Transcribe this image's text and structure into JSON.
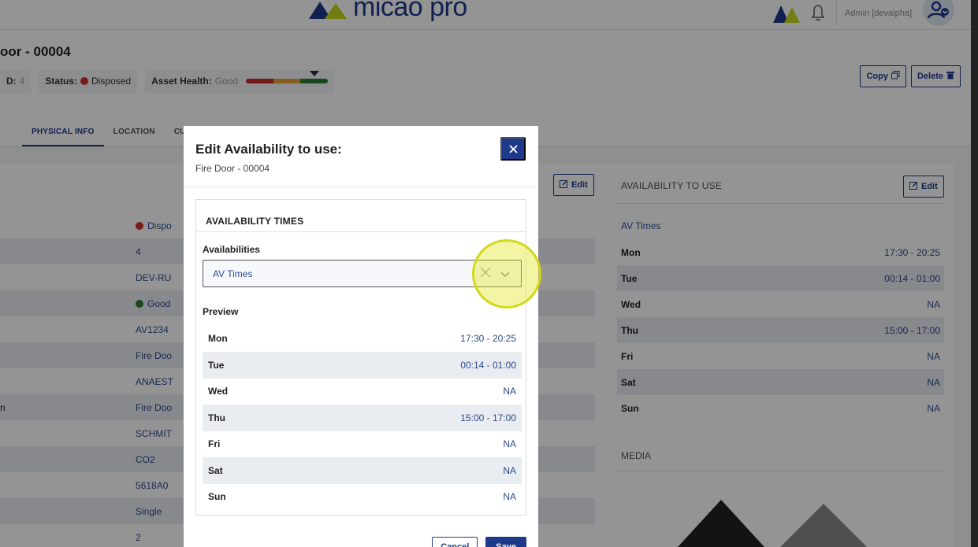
{
  "app": {
    "logo_text": "micao pro",
    "admin_label": "Admin [devalpha]"
  },
  "asset": {
    "title": "oor - 00004",
    "id_label": "D:",
    "id_value": "4",
    "status_label": "Status:",
    "status_value": "Disposed",
    "health_label": "Asset Health:",
    "health_value": "Good",
    "status_color": "#d32f2f",
    "health_colors": [
      "#c62828",
      "#e6a23c",
      "#2e7d32"
    ]
  },
  "actions": {
    "copy_label": "Copy",
    "delete_label": "Delete"
  },
  "tabs": [
    {
      "label": "PHYSICAL INFO"
    },
    {
      "label": "LOCATION"
    },
    {
      "label": "CU"
    }
  ],
  "left_panel": {
    "edit_label": "Edit",
    "rows": [
      {
        "label": "",
        "value": "Dispo",
        "dot": "#d32f2f"
      },
      {
        "label": "",
        "value": "4"
      },
      {
        "label": "",
        "value": "DEV-RU"
      },
      {
        "label": "",
        "value": "Good",
        "dot": "#2e7d32"
      },
      {
        "label": "",
        "value": "AV1234"
      },
      {
        "label": "",
        "value": "Fire Doo"
      },
      {
        "label": "",
        "value": "ANAEST"
      },
      {
        "label": "n",
        "value": "Fire Doo"
      },
      {
        "label": "",
        "value": "SCHMIT"
      },
      {
        "label": "",
        "value": "CO2"
      },
      {
        "label": "",
        "value": "5618A0"
      },
      {
        "label": "",
        "value": "Single"
      },
      {
        "label": "",
        "value": "2"
      }
    ]
  },
  "right_panel": {
    "title": "AVAILABILITY TO USE",
    "edit_label": "Edit",
    "subtitle": "AV Times",
    "rows": [
      {
        "day": "Mon",
        "time": "17:30 - 20:25"
      },
      {
        "day": "Tue",
        "time": "00:14 - 01:00"
      },
      {
        "day": "Wed",
        "time": "NA"
      },
      {
        "day": "Thu",
        "time": "15:00 - 17:00"
      },
      {
        "day": "Fri",
        "time": "NA"
      },
      {
        "day": "Sat",
        "time": "NA"
      },
      {
        "day": "Sun",
        "time": "NA"
      }
    ],
    "media_title": "MEDIA"
  },
  "modal": {
    "title": "Edit Availability to use:",
    "subtitle": "Fire Door - 00004",
    "card_title": "AVAILABILITY TIMES",
    "field_label": "Availabilities",
    "selected_value": "AV Times",
    "preview_label": "Preview",
    "preview_rows": [
      {
        "day": "Mon",
        "time": "17:30 - 20:25"
      },
      {
        "day": "Tue",
        "time": "00:14 - 01:00"
      },
      {
        "day": "Wed",
        "time": "NA"
      },
      {
        "day": "Thu",
        "time": "15:00 - 17:00"
      },
      {
        "day": "Fri",
        "time": "NA"
      },
      {
        "day": "Sat",
        "time": "NA"
      },
      {
        "day": "Sun",
        "time": "NA"
      }
    ],
    "cancel_label": "Cancel",
    "save_label": "Save"
  }
}
